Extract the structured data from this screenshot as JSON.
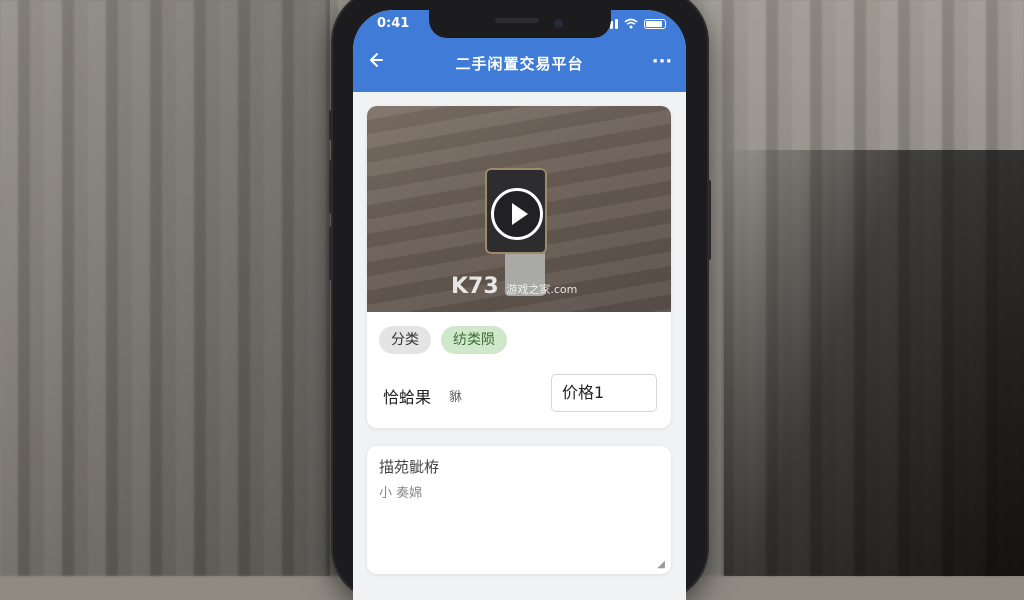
{
  "status_bar": {
    "time": "0:41"
  },
  "header": {
    "title": "二手闲置交易平台",
    "back_icon": "back-arrow-icon",
    "more_icon": "more-dots-icon"
  },
  "video": {
    "play_icon": "play-icon",
    "watermark_logo": "K73",
    "watermark_text": "游戏之家",
    "watermark_domain": ".com"
  },
  "tags": [
    {
      "label": "分类"
    },
    {
      "label": "纺类陨"
    }
  ],
  "price": {
    "label": "恰蛤果",
    "unit": "貅",
    "input_value": "价格1"
  },
  "description": {
    "title": "描苑骴栫",
    "text": "小 奏婂"
  },
  "colors": {
    "header_bg": "#3f7bd7",
    "tag_green_bg": "#cfe8c9",
    "tag_gray_bg": "#e4e4e4"
  }
}
